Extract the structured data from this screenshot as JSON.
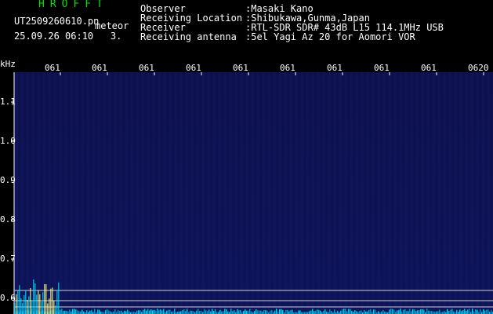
{
  "header": {
    "brand": "HROFFT",
    "filename": "UT2509260610.pn",
    "tag": "meteor",
    "datetime": "25.09.26 06:10",
    "count": "3."
  },
  "meta": [
    {
      "label": "Observer",
      "value": ":Masaki Kano"
    },
    {
      "label": "Receiving Location",
      "value": ":Shibukawa,Gunma,Japan"
    },
    {
      "label": "Receiver",
      "value": ":RTL-SDR SDR# 43dB L15 114.1MHz USB"
    },
    {
      "label": "Receiving antenna",
      "value": ":5el Yagi Az 20 for Aomori VOR"
    }
  ],
  "axes": {
    "y_unit": "kHz",
    "y_ticks": [
      "1.1",
      "1.0",
      "0.9",
      "0.8",
      "0.7",
      "0.6"
    ],
    "x_ticks": [
      "061",
      "061",
      "061",
      "061",
      "061",
      "061",
      "061",
      "061",
      "061",
      "0620"
    ]
  },
  "colors": {
    "background": "#000000",
    "brand": "#00e000",
    "spectrum_bg": "#0c1152",
    "signal": "#00e0ff",
    "reference_line": "#d0d0d0"
  }
}
